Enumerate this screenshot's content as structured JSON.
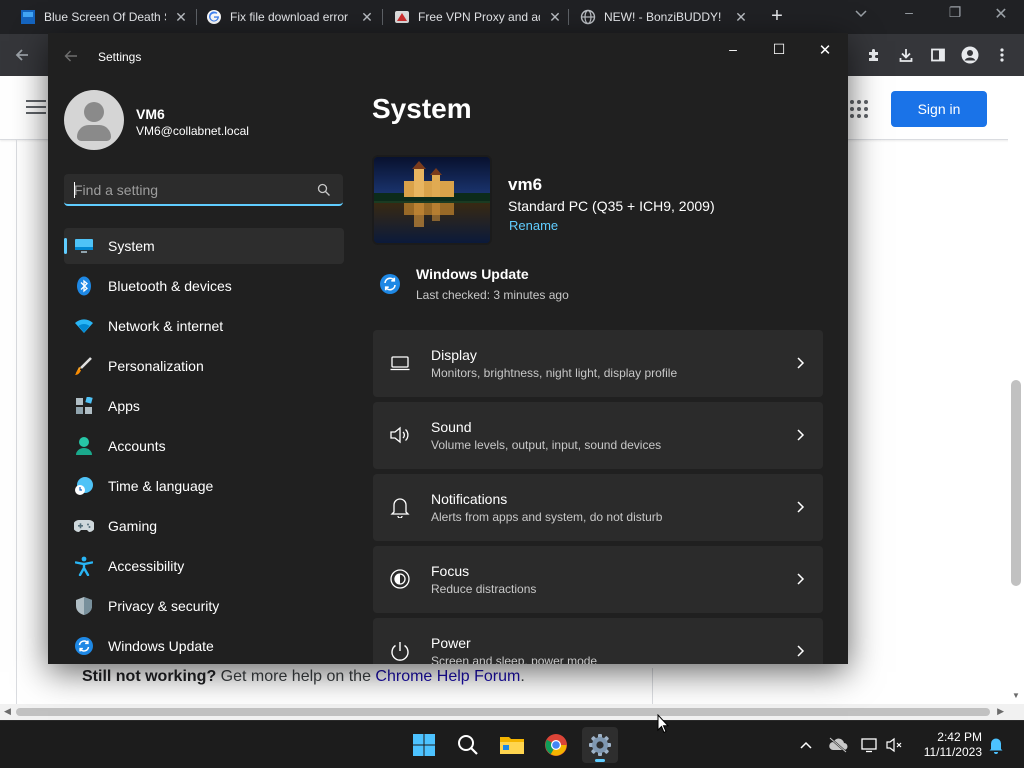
{
  "browser": {
    "tabs": [
      {
        "title": "Blue Screen Of Death S",
        "icon": "blue-square-favicon"
      },
      {
        "title": "Fix file download error",
        "icon": "google-favicon"
      },
      {
        "title": "Free VPN Proxy and ad",
        "icon": "vpn-favicon"
      },
      {
        "title": "NEW! - BonziBUDDY!",
        "icon": "globe-favicon"
      }
    ],
    "tab_close_glyph": "✕",
    "new_tab_glyph": "+",
    "window_controls": {
      "minimize": "–",
      "maximize": "❐",
      "close": "✕"
    }
  },
  "webpage": {
    "sign_in_label": "Sign in",
    "help_bold": "Still not working?",
    "help_text": " Get more help on the ",
    "help_link": "Chrome Help Forum",
    "help_end": "."
  },
  "settings": {
    "app_title": "Settings",
    "window_controls": {
      "minimize": "–",
      "maximize": "☐",
      "close": "✕"
    },
    "profile": {
      "name": "VM6",
      "email": "VM6@collabnet.local"
    },
    "search": {
      "placeholder": "Find a setting"
    },
    "nav": [
      {
        "label": "System",
        "icon": "system-monitor-icon",
        "selected": true
      },
      {
        "label": "Bluetooth & devices",
        "icon": "bluetooth-icon"
      },
      {
        "label": "Network & internet",
        "icon": "wifi-icon"
      },
      {
        "label": "Personalization",
        "icon": "paintbrush-icon"
      },
      {
        "label": "Apps",
        "icon": "apps-icon"
      },
      {
        "label": "Accounts",
        "icon": "accounts-icon"
      },
      {
        "label": "Time & language",
        "icon": "time-language-icon"
      },
      {
        "label": "Gaming",
        "icon": "gamepad-icon"
      },
      {
        "label": "Accessibility",
        "icon": "accessibility-icon"
      },
      {
        "label": "Privacy & security",
        "icon": "shield-icon"
      },
      {
        "label": "Windows Update",
        "icon": "windows-update-icon"
      }
    ],
    "page_title": "System",
    "device": {
      "name": "vm6",
      "model": "Standard PC (Q35 + ICH9, 2009)",
      "rename": "Rename"
    },
    "windows_update": {
      "title": "Windows Update",
      "status": "Last checked: 3 minutes ago"
    },
    "cards": [
      {
        "title": "Display",
        "subtitle": "Monitors, brightness, night light, display profile",
        "icon": "display-icon"
      },
      {
        "title": "Sound",
        "subtitle": "Volume levels, output, input, sound devices",
        "icon": "speaker-icon"
      },
      {
        "title": "Notifications",
        "subtitle": "Alerts from apps and system, do not disturb",
        "icon": "bell-icon"
      },
      {
        "title": "Focus",
        "subtitle": "Reduce distractions",
        "icon": "focus-icon"
      },
      {
        "title": "Power",
        "subtitle": "Screen and sleep, power mode",
        "icon": "power-icon"
      }
    ]
  },
  "taskbar": {
    "clock_time": "2:42 PM",
    "clock_date": "11/11/2023"
  },
  "colors": {
    "accent": "#60cdff",
    "chrome_blue": "#1a73e8",
    "settings_bg": "#202020",
    "card_bg": "#2b2b2b"
  }
}
